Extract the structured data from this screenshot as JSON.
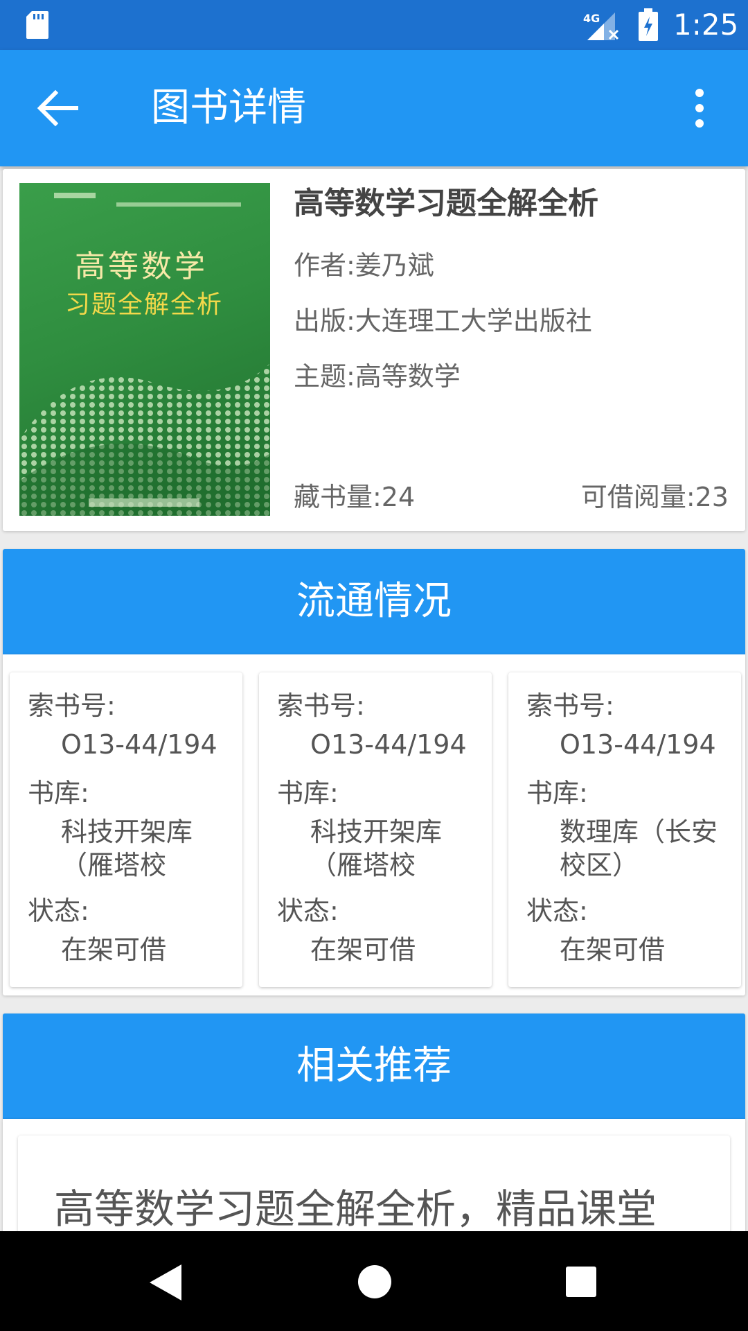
{
  "status_bar": {
    "time": "1:25",
    "network": "4G",
    "icons": [
      "sd-card-icon",
      "signal-4g-icon",
      "battery-charging-icon"
    ]
  },
  "app_bar": {
    "title": "图书详情",
    "back_icon": "arrow-back-icon",
    "menu_icon": "more-vert-icon"
  },
  "book": {
    "title": "高等数学习题全解全析",
    "author": "作者:姜乃斌",
    "publisher": "出版:大连理工大学出版社",
    "topic": "主题:高等数学",
    "holdings": "藏书量:24",
    "available": "可借阅量:23",
    "cover": {
      "title_line1": "高等数学",
      "title_line2": "习题全解全析"
    }
  },
  "circulation": {
    "header": "流通情况",
    "copies": [
      {
        "call_label": "索书号:",
        "call_number": "O13-44/194",
        "library_label": "书库:",
        "library": "科技开架库（雁塔校",
        "status_label": "状态:",
        "status": "在架可借"
      },
      {
        "call_label": "索书号:",
        "call_number": "O13-44/194",
        "library_label": "书库:",
        "library": "科技开架库（雁塔校",
        "status_label": "状态:",
        "status": "在架可借"
      },
      {
        "call_label": "索书号:",
        "call_number": "O13-44/194",
        "library_label": "书库:",
        "library": "数理库（长安校区）",
        "status_label": "状态:",
        "status": "在架可借"
      }
    ]
  },
  "recommendations": {
    "header": "相关推荐",
    "items": [
      {
        "title": "高等数学习题全解全析，精品课堂"
      }
    ]
  },
  "nav_bar": {
    "icons": [
      "nav-back-icon",
      "nav-home-icon",
      "nav-recent-icon"
    ]
  },
  "colors": {
    "status_bar": "#1d71cf",
    "primary": "#2196f3",
    "background": "#ececec",
    "nav_bar": "#000000"
  }
}
